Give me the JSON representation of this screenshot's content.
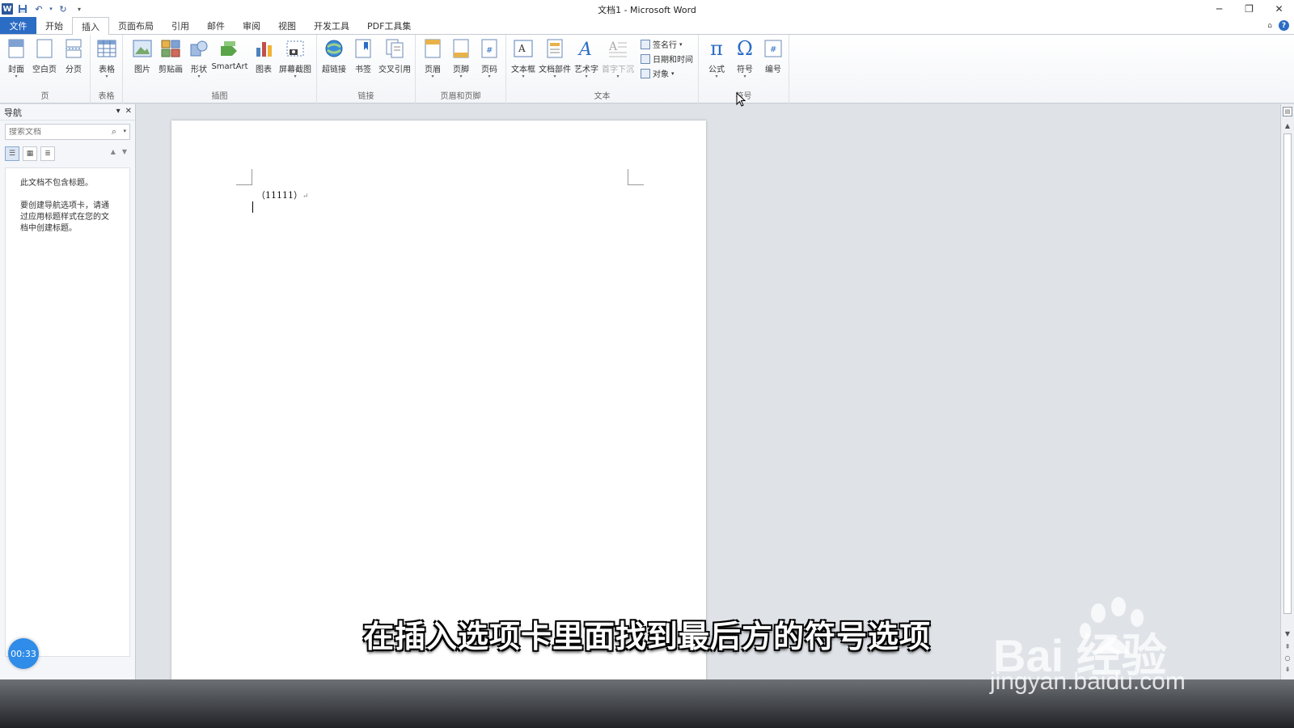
{
  "window": {
    "title": "文档1 - Microsoft Word"
  },
  "tabs": [
    {
      "label": "文件"
    },
    {
      "label": "开始"
    },
    {
      "label": "插入"
    },
    {
      "label": "页面布局"
    },
    {
      "label": "引用"
    },
    {
      "label": "邮件"
    },
    {
      "label": "审阅"
    },
    {
      "label": "视图"
    },
    {
      "label": "开发工具"
    },
    {
      "label": "PDF工具集"
    }
  ],
  "ribbon": {
    "groups": {
      "page": "页",
      "table": "表格",
      "illustrations": "插图",
      "links": "链接",
      "header_footer": "页眉和页脚",
      "text": "文本",
      "symbols": "符号"
    },
    "buttons": {
      "cover": "封面",
      "blank_page": "空白页",
      "page_break": "分页",
      "table": "表格",
      "picture": "图片",
      "clipart": "剪贴画",
      "shapes": "形状",
      "smartart": "SmartArt",
      "chart": "图表",
      "screenshot": "屏幕截图",
      "hyperlink": "超链接",
      "bookmark": "书签",
      "cross_ref": "交叉引用",
      "header": "页眉",
      "footer": "页脚",
      "page_number": "页码",
      "textbox": "文本框",
      "quick_parts": "文档部件",
      "wordart": "艺术字",
      "dropcap": "首字下沉",
      "signature": "签名行",
      "datetime": "日期和时间",
      "object": "对象",
      "equation": "公式",
      "symbol": "符号",
      "numbering": "编号"
    }
  },
  "nav": {
    "title": "导航",
    "search_placeholder": "搜索文档",
    "message1": "此文档不包含标题。",
    "message2": "要创建导航选项卡，请通过应用标题样式在您的文档中创建标题。"
  },
  "document": {
    "line1": "（11111）"
  },
  "timer": "00:33",
  "subtitle": "在插入选项卡里面找到最后方的符号选项",
  "watermark": {
    "logo": "Bai  经验",
    "url": "jingyan.baidu.com"
  },
  "colors": {
    "accent": "#2b6cc4",
    "timer": "#2f8ce8"
  }
}
